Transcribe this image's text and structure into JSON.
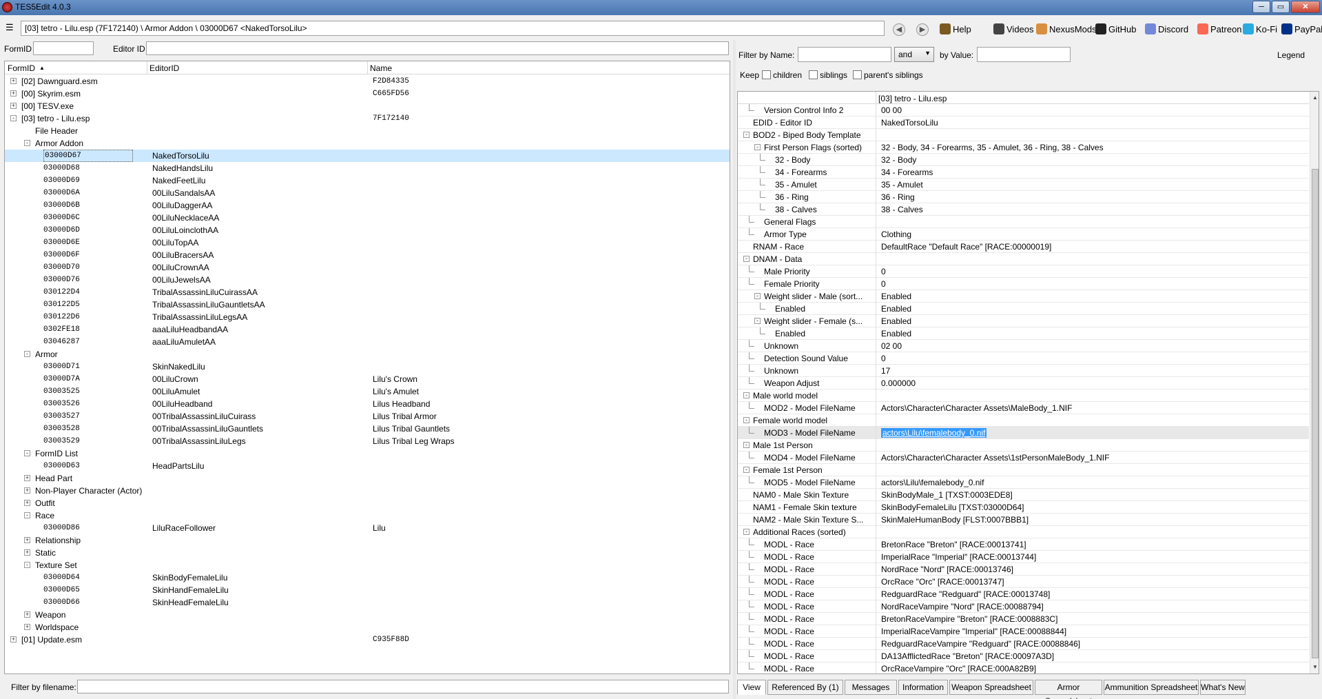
{
  "window": {
    "title": "TES5Edit 4.0.3"
  },
  "toolbar": {
    "path": "[03] tetro - Lilu.esp (7F172140) \\ Armor Addon \\ 03000D67 <NakedTorsoLilu>",
    "links": [
      {
        "label": "Help",
        "icon": "book-icon",
        "color": "#7a5a20"
      },
      {
        "label": "Videos",
        "icon": "video-icon",
        "color": "#444444"
      },
      {
        "label": "NexusMods",
        "icon": "nexusmods-icon",
        "color": "#d98f40"
      },
      {
        "label": "GitHub",
        "icon": "github-icon",
        "color": "#222222"
      },
      {
        "label": "Discord",
        "icon": "discord-icon",
        "color": "#7289da"
      },
      {
        "label": "Patreon",
        "icon": "patreon-icon",
        "color": "#f96854"
      },
      {
        "label": "Ko-Fi",
        "icon": "kofi-icon",
        "color": "#29abe0"
      },
      {
        "label": "PayPal",
        "icon": "paypal-icon",
        "color": "#003087"
      }
    ]
  },
  "left": {
    "formid_label": "FormID",
    "editorid_label": "Editor ID",
    "columns": [
      "FormID",
      "EditorID",
      "Name"
    ],
    "filter_label": "Filter by filename:",
    "rows": [
      {
        "lvl": 0,
        "exp": "+",
        "c1": "[02] Dawnguard.esm",
        "c2": "",
        "c3": "F2D84335"
      },
      {
        "lvl": 0,
        "exp": "+",
        "c1": "[00] Skyrim.esm",
        "c2": "",
        "c3": "C665FD56"
      },
      {
        "lvl": 0,
        "exp": "+",
        "c1": "[00] TESV.exe",
        "c2": "",
        "c3": ""
      },
      {
        "lvl": 0,
        "exp": "-",
        "c1": "[03] tetro - Lilu.esp",
        "c2": "",
        "c3": "7F172140"
      },
      {
        "lvl": 1,
        "exp": "",
        "c1": "File Header",
        "c2": "",
        "c3": ""
      },
      {
        "lvl": 1,
        "exp": "-",
        "c1": "Armor Addon",
        "c2": "",
        "c3": ""
      },
      {
        "lvl": 2,
        "exp": "",
        "c1": "03000D67",
        "c2": "NakedTorsoLilu",
        "c3": "",
        "sel": true,
        "mono": true
      },
      {
        "lvl": 2,
        "exp": "",
        "c1": "03000D68",
        "c2": "NakedHandsLilu",
        "c3": "",
        "mono": true
      },
      {
        "lvl": 2,
        "exp": "",
        "c1": "03000D69",
        "c2": "NakedFeetLilu",
        "c3": "",
        "mono": true
      },
      {
        "lvl": 2,
        "exp": "",
        "c1": "03000D6A",
        "c2": "00LiluSandalsAA",
        "c3": "",
        "mono": true
      },
      {
        "lvl": 2,
        "exp": "",
        "c1": "03000D6B",
        "c2": "00LiluDaggerAA",
        "c3": "",
        "mono": true
      },
      {
        "lvl": 2,
        "exp": "",
        "c1": "03000D6C",
        "c2": "00LiluNecklaceAA",
        "c3": "",
        "mono": true
      },
      {
        "lvl": 2,
        "exp": "",
        "c1": "03000D6D",
        "c2": "00LiluLoinclothAA",
        "c3": "",
        "mono": true
      },
      {
        "lvl": 2,
        "exp": "",
        "c1": "03000D6E",
        "c2": "00LiluTopAA",
        "c3": "",
        "mono": true
      },
      {
        "lvl": 2,
        "exp": "",
        "c1": "03000D6F",
        "c2": "00LiluBracersAA",
        "c3": "",
        "mono": true
      },
      {
        "lvl": 2,
        "exp": "",
        "c1": "03000D70",
        "c2": "00LiluCrownAA",
        "c3": "",
        "mono": true
      },
      {
        "lvl": 2,
        "exp": "",
        "c1": "03000D76",
        "c2": "00LiluJewelsAA",
        "c3": "",
        "mono": true
      },
      {
        "lvl": 2,
        "exp": "",
        "c1": "030122D4",
        "c2": "TribalAssassinLiluCuirassAA",
        "c3": "",
        "mono": true
      },
      {
        "lvl": 2,
        "exp": "",
        "c1": "030122D5",
        "c2": "TribalAssassinLiluGauntletsAA",
        "c3": "",
        "mono": true
      },
      {
        "lvl": 2,
        "exp": "",
        "c1": "030122D6",
        "c2": "TribalAssassinLiluLegsAA",
        "c3": "",
        "mono": true
      },
      {
        "lvl": 2,
        "exp": "",
        "c1": "0302FE18",
        "c2": "aaaLiluHeadbandAA",
        "c3": "",
        "mono": true
      },
      {
        "lvl": 2,
        "exp": "",
        "c1": "03046287",
        "c2": "aaaLiluAmuletAA",
        "c3": "",
        "mono": true
      },
      {
        "lvl": 1,
        "exp": "-",
        "c1": "Armor",
        "c2": "",
        "c3": ""
      },
      {
        "lvl": 2,
        "exp": "",
        "c1": "03000D71",
        "c2": "SkinNakedLilu",
        "c3": "",
        "mono": true
      },
      {
        "lvl": 2,
        "exp": "",
        "c1": "03000D7A",
        "c2": "00LiluCrown",
        "c3": "Lilu's Crown",
        "mono": true
      },
      {
        "lvl": 2,
        "exp": "",
        "c1": "03003525",
        "c2": "00LiluAmulet",
        "c3": "Lilu's Amulet",
        "mono": true
      },
      {
        "lvl": 2,
        "exp": "",
        "c1": "03003526",
        "c2": "00LiluHeadband",
        "c3": "Lilus Headband",
        "mono": true
      },
      {
        "lvl": 2,
        "exp": "",
        "c1": "03003527",
        "c2": "00TribalAssassinLiluCuirass",
        "c3": "Lilus Tribal Armor",
        "mono": true
      },
      {
        "lvl": 2,
        "exp": "",
        "c1": "03003528",
        "c2": "00TribalAssassinLiluGauntlets",
        "c3": "Lilus Tribal Gauntlets",
        "mono": true
      },
      {
        "lvl": 2,
        "exp": "",
        "c1": "03003529",
        "c2": "00TribalAssassinLiluLegs",
        "c3": "Lilus Tribal Leg Wraps",
        "mono": true
      },
      {
        "lvl": 1,
        "exp": "-",
        "c1": "FormID List",
        "c2": "",
        "c3": ""
      },
      {
        "lvl": 2,
        "exp": "",
        "c1": "03000D63",
        "c2": "HeadPartsLilu",
        "c3": "",
        "mono": true
      },
      {
        "lvl": 1,
        "exp": "+",
        "c1": "Head Part",
        "c2": "",
        "c3": ""
      },
      {
        "lvl": 1,
        "exp": "+",
        "c1": "Non-Player Character (Actor)",
        "c2": "",
        "c3": ""
      },
      {
        "lvl": 1,
        "exp": "+",
        "c1": "Outfit",
        "c2": "",
        "c3": ""
      },
      {
        "lvl": 1,
        "exp": "-",
        "c1": "Race",
        "c2": "",
        "c3": ""
      },
      {
        "lvl": 2,
        "exp": "",
        "c1": "03000D86",
        "c2": "LiluRaceFollower",
        "c3": "Lilu",
        "mono": true
      },
      {
        "lvl": 1,
        "exp": "+",
        "c1": "Relationship",
        "c2": "",
        "c3": ""
      },
      {
        "lvl": 1,
        "exp": "+",
        "c1": "Static",
        "c2": "",
        "c3": ""
      },
      {
        "lvl": 1,
        "exp": "-",
        "c1": "Texture Set",
        "c2": "",
        "c3": ""
      },
      {
        "lvl": 2,
        "exp": "",
        "c1": "03000D64",
        "c2": "SkinBodyFemaleLilu",
        "c3": "",
        "mono": true
      },
      {
        "lvl": 2,
        "exp": "",
        "c1": "03000D65",
        "c2": "SkinHandFemaleLilu",
        "c3": "",
        "mono": true
      },
      {
        "lvl": 2,
        "exp": "",
        "c1": "03000D66",
        "c2": "SkinHeadFemaleLilu",
        "c3": "",
        "mono": true
      },
      {
        "lvl": 1,
        "exp": "+",
        "c1": "Weapon",
        "c2": "",
        "c3": ""
      },
      {
        "lvl": 1,
        "exp": "+",
        "c1": "Worldspace",
        "c2": "",
        "c3": ""
      },
      {
        "lvl": 0,
        "exp": "+",
        "c1": "[01] Update.esm",
        "c2": "",
        "c3": "C935F88D"
      }
    ]
  },
  "right": {
    "filter_name_label": "Filter by Name:",
    "and_value": "and",
    "filter_value_label": "by Value:",
    "legend_label": "Legend",
    "keep_label": "Keep",
    "keep_options": [
      "children",
      "siblings",
      "parent's siblings"
    ],
    "file_header": "[03] tetro - Lilu.esp",
    "rows": [
      {
        "lvl": 1,
        "exp": "",
        "lbl": "Version Control Info 2",
        "val": "00 00"
      },
      {
        "lvl": 0,
        "exp": "",
        "lbl": "EDID - Editor ID",
        "val": "NakedTorsoLilu"
      },
      {
        "lvl": 0,
        "exp": "-",
        "lbl": "BOD2 - Biped Body Template",
        "val": ""
      },
      {
        "lvl": 1,
        "exp": "-",
        "lbl": "First Person Flags (sorted)",
        "val": "32 - Body, 34 - Forearms, 35 - Amulet, 36 - Ring, 38 - Calves"
      },
      {
        "lvl": 2,
        "exp": "",
        "lbl": "32 - Body",
        "val": "32 - Body"
      },
      {
        "lvl": 2,
        "exp": "",
        "lbl": "34 - Forearms",
        "val": "34 - Forearms"
      },
      {
        "lvl": 2,
        "exp": "",
        "lbl": "35 - Amulet",
        "val": "35 - Amulet"
      },
      {
        "lvl": 2,
        "exp": "",
        "lbl": "36 - Ring",
        "val": "36 - Ring"
      },
      {
        "lvl": 2,
        "exp": "",
        "lbl": "38 - Calves",
        "val": "38 - Calves"
      },
      {
        "lvl": 1,
        "exp": "",
        "lbl": "General Flags",
        "val": ""
      },
      {
        "lvl": 1,
        "exp": "",
        "lbl": "Armor Type",
        "val": "Clothing"
      },
      {
        "lvl": 0,
        "exp": "",
        "lbl": "RNAM - Race",
        "val": "DefaultRace \"Default Race\" [RACE:00000019]"
      },
      {
        "lvl": 0,
        "exp": "-",
        "lbl": "DNAM - Data",
        "val": ""
      },
      {
        "lvl": 1,
        "exp": "",
        "lbl": "Male Priority",
        "val": "0"
      },
      {
        "lvl": 1,
        "exp": "",
        "lbl": "Female Priority",
        "val": "0"
      },
      {
        "lvl": 1,
        "exp": "-",
        "lbl": "Weight slider - Male (sort...",
        "val": "Enabled"
      },
      {
        "lvl": 2,
        "exp": "",
        "lbl": "Enabled",
        "val": "Enabled"
      },
      {
        "lvl": 1,
        "exp": "-",
        "lbl": "Weight slider - Female (s...",
        "val": "Enabled"
      },
      {
        "lvl": 2,
        "exp": "",
        "lbl": "Enabled",
        "val": "Enabled"
      },
      {
        "lvl": 1,
        "exp": "",
        "lbl": "Unknown",
        "val": "02 00"
      },
      {
        "lvl": 1,
        "exp": "",
        "lbl": "Detection Sound Value",
        "val": "0"
      },
      {
        "lvl": 1,
        "exp": "",
        "lbl": "Unknown",
        "val": "17"
      },
      {
        "lvl": 1,
        "exp": "",
        "lbl": "Weapon Adjust",
        "val": "0.000000"
      },
      {
        "lvl": 0,
        "exp": "-",
        "lbl": "Male world model",
        "val": ""
      },
      {
        "lvl": 1,
        "exp": "",
        "lbl": "MOD2 - Model FileName",
        "val": "Actors\\Character\\Character Assets\\MaleBody_1.NIF"
      },
      {
        "lvl": 0,
        "exp": "-",
        "lbl": "Female world model",
        "val": ""
      },
      {
        "lvl": 1,
        "exp": "",
        "lbl": "MOD3 - Model FileName",
        "val": "actors\\Lilu\\femalebody_0.nif",
        "hl": true
      },
      {
        "lvl": 0,
        "exp": "-",
        "lbl": "Male 1st Person",
        "val": ""
      },
      {
        "lvl": 1,
        "exp": "",
        "lbl": "MOD4 - Model FileName",
        "val": "Actors\\Character\\Character Assets\\1stPersonMaleBody_1.NIF"
      },
      {
        "lvl": 0,
        "exp": "-",
        "lbl": "Female 1st Person",
        "val": ""
      },
      {
        "lvl": 1,
        "exp": "",
        "lbl": "MOD5 - Model FileName",
        "val": "actors\\Lilu\\femalebody_0.nif"
      },
      {
        "lvl": 0,
        "exp": "",
        "lbl": "NAM0 - Male Skin Texture",
        "val": "SkinBodyMale_1 [TXST:0003EDE8]"
      },
      {
        "lvl": 0,
        "exp": "",
        "lbl": "NAM1 - Female Skin texture",
        "val": "SkinBodyFemaleLilu [TXST:03000D64]"
      },
      {
        "lvl": 0,
        "exp": "",
        "lbl": "NAM2 - Male Skin Texture S...",
        "val": "SkinMaleHumanBody [FLST:0007BBB1]"
      },
      {
        "lvl": 0,
        "exp": "-",
        "lbl": "Additional Races (sorted)",
        "val": ""
      },
      {
        "lvl": 1,
        "exp": "",
        "lbl": "MODL - Race",
        "val": "BretonRace \"Breton\" [RACE:00013741]"
      },
      {
        "lvl": 1,
        "exp": "",
        "lbl": "MODL - Race",
        "val": "ImperialRace \"Imperial\" [RACE:00013744]"
      },
      {
        "lvl": 1,
        "exp": "",
        "lbl": "MODL - Race",
        "val": "NordRace \"Nord\" [RACE:00013746]"
      },
      {
        "lvl": 1,
        "exp": "",
        "lbl": "MODL - Race",
        "val": "OrcRace \"Orc\" [RACE:00013747]"
      },
      {
        "lvl": 1,
        "exp": "",
        "lbl": "MODL - Race",
        "val": "RedguardRace \"Redguard\" [RACE:00013748]"
      },
      {
        "lvl": 1,
        "exp": "",
        "lbl": "MODL - Race",
        "val": "NordRaceVampire \"Nord\" [RACE:00088794]"
      },
      {
        "lvl": 1,
        "exp": "",
        "lbl": "MODL - Race",
        "val": "BretonRaceVampire \"Breton\" [RACE:0008883C]"
      },
      {
        "lvl": 1,
        "exp": "",
        "lbl": "MODL - Race",
        "val": "ImperialRaceVampire \"Imperial\" [RACE:00088844]"
      },
      {
        "lvl": 1,
        "exp": "",
        "lbl": "MODL - Race",
        "val": "RedguardRaceVampire \"Redguard\" [RACE:00088846]"
      },
      {
        "lvl": 1,
        "exp": "",
        "lbl": "MODL - Race",
        "val": "DA13AfflictedRace \"Breton\" [RACE:00097A3D]"
      },
      {
        "lvl": 1,
        "exp": "",
        "lbl": "MODL - Race",
        "val": "OrcRaceVampire \"Orc\" [RACE:000A82B9]"
      }
    ],
    "tabs": [
      "View",
      "Referenced By (1)",
      "Messages",
      "Information",
      "Weapon Spreadsheet",
      "Armor Spreadsheet",
      "Ammunition Spreadsheet",
      "What's New"
    ]
  }
}
